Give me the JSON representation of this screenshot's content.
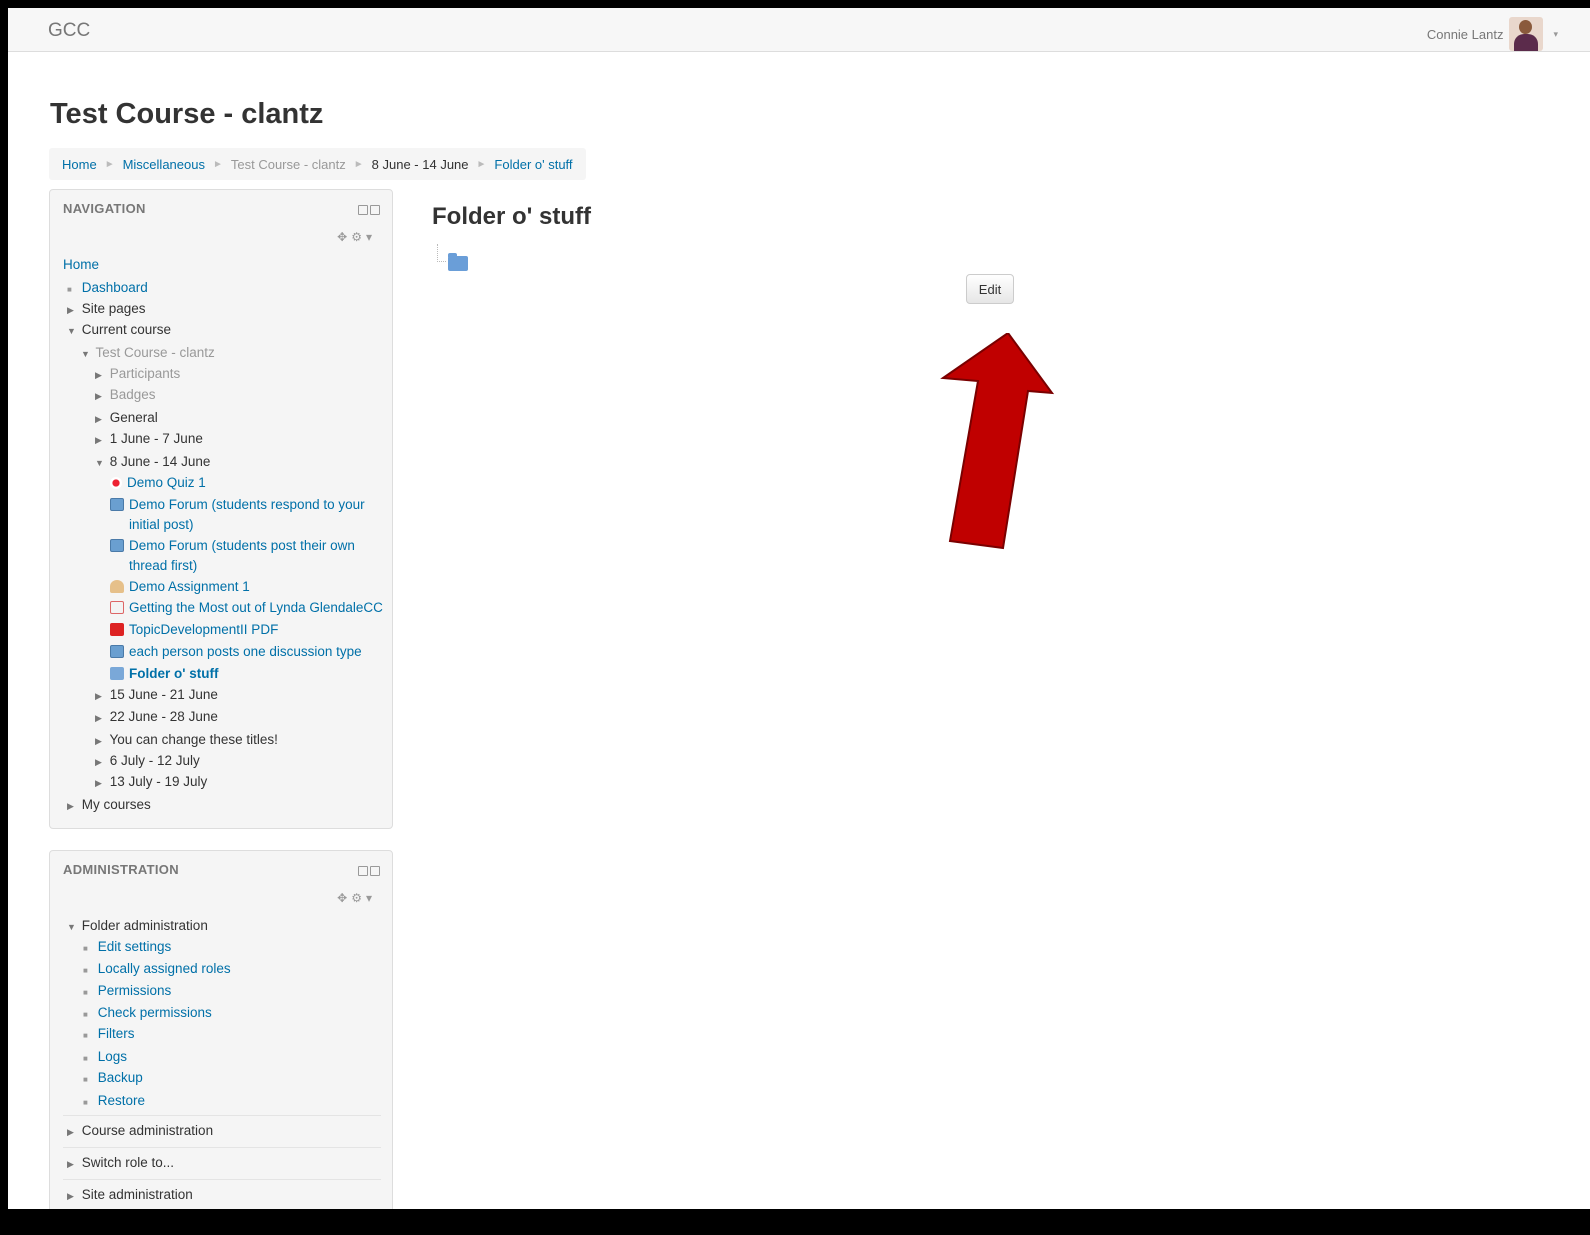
{
  "navbar": {
    "brand": "GCC",
    "user_name": "Connie Lantz",
    "user_caret": "▾"
  },
  "page": {
    "title": "Test Course - clantz"
  },
  "breadcrumb": {
    "items": [
      "Home",
      "Miscellaneous",
      "Test Course - clantz",
      "8 June - 14 June",
      "Folder o' stuff"
    ],
    "separator": "►"
  },
  "navigation": {
    "title": "NAVIGATION",
    "items": [
      "Home",
      "Dashboard",
      "Site pages",
      "Current course",
      "Test Course - clantz",
      "Participants",
      "Badges",
      "General",
      "1 June - 7 June",
      "8 June - 14 June",
      "Demo Quiz 1",
      "Demo Forum (students respond to your",
      "initial post)",
      "Demo Forum (students post their own",
      "thread first)",
      "Demo Assignment 1",
      "Getting the Most out of Lynda GlendaleCC",
      "TopicDevelopmentII PDF",
      "each person posts one discussion type",
      "Folder o' stuff",
      "15 June - 21 June",
      "22 June - 28 June",
      "You can change these titles!",
      "6 July - 12 July",
      "13 July - 19 July",
      "My courses"
    ]
  },
  "administration": {
    "title": "ADMINISTRATION",
    "items": [
      "Folder administration",
      "Edit settings",
      "Locally assigned roles",
      "Permissions",
      "Check permissions",
      "Filters",
      "Logs",
      "Backup",
      "Restore",
      "Course administration",
      "Switch role to...",
      "Site administration"
    ]
  },
  "main": {
    "title": "Folder o' stuff",
    "edit_label": "Edit"
  },
  "colors": {
    "link": "#0070a8",
    "annotation_arrow": "#c00000"
  }
}
